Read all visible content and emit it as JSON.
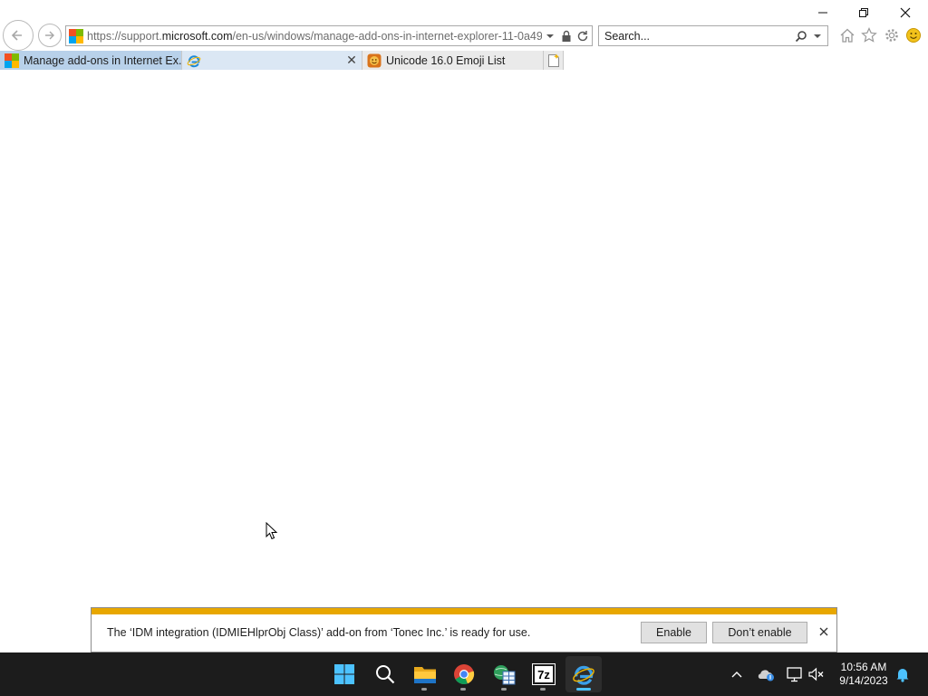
{
  "browser": {
    "address_url_host_prefix": "https://support.",
    "address_url_domain": "microsoft.com",
    "address_url_path": "/en-us/windows/manage-add-ons-in-internet-explorer-11-0a49(",
    "search_placeholder": "Search..."
  },
  "tabs": [
    {
      "label": "Manage add-ons in Internet Ex...",
      "favicon": "microsoft-logo"
    },
    {
      "label": "",
      "favicon": "ie-logo",
      "close_glyph": "✕"
    },
    {
      "label": "Unicode 16.0 Emoji List",
      "favicon": "emoji-icon"
    }
  ],
  "notification": {
    "message": "The ‘IDM integration (IDMIEHlprObj Class)’ add-on from ‘Tonec Inc.’ is ready for use.",
    "enable_label": "Enable",
    "dont_enable_label": "Don’t enable",
    "close_glyph": "✕",
    "accent_color": "#e8a700"
  },
  "taskbar": {
    "apps": [
      "start",
      "search",
      "file-explorer",
      "chrome",
      "excel",
      "7-zip",
      "internet-explorer"
    ],
    "active_app": "internet-explorer",
    "sevenzip_label": "7z",
    "time": "10:56 AM",
    "date": "9/14/2023"
  },
  "colors": {
    "active_tab": "#b8d1ea",
    "taskbar_bg": "#1c1c1c",
    "taskbar_accent": "#4cc2ff"
  }
}
